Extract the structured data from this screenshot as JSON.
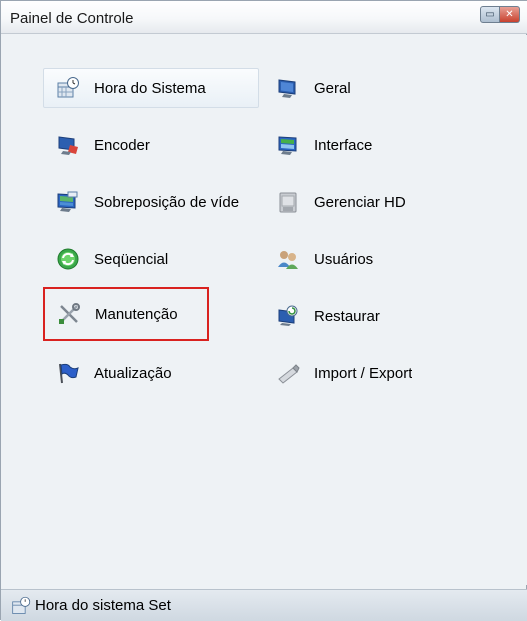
{
  "window": {
    "title": "Painel de Controle",
    "minimize_glyph": "▭",
    "close_glyph": "✕"
  },
  "menu": {
    "items": [
      {
        "label": "Hora do Sistema",
        "icon": "clock-calendar-icon"
      },
      {
        "label": "Geral",
        "icon": "monitor-icon"
      },
      {
        "label": "Encoder",
        "icon": "encoder-monitor-icon"
      },
      {
        "label": "Interface",
        "icon": "interface-monitor-icon"
      },
      {
        "label": "Sobreposição de víde",
        "icon": "video-overlay-icon"
      },
      {
        "label": "Gerenciar HD",
        "icon": "hard-disk-icon"
      },
      {
        "label": "Seqüencial",
        "icon": "sequence-cycle-icon"
      },
      {
        "label": "Usuários",
        "icon": "users-icon"
      },
      {
        "label": "Manutenção",
        "icon": "tools-icon"
      },
      {
        "label": "Restaurar",
        "icon": "restore-icon"
      },
      {
        "label": "Atualização",
        "icon": "update-flag-icon"
      },
      {
        "label": "Import / Export",
        "icon": "usb-drive-icon"
      }
    ]
  },
  "status": {
    "text": "Hora do sistema Set",
    "icon": "clock-calendar-icon"
  },
  "colors": {
    "highlight": "#d9221f",
    "background": "#eef2f5"
  }
}
